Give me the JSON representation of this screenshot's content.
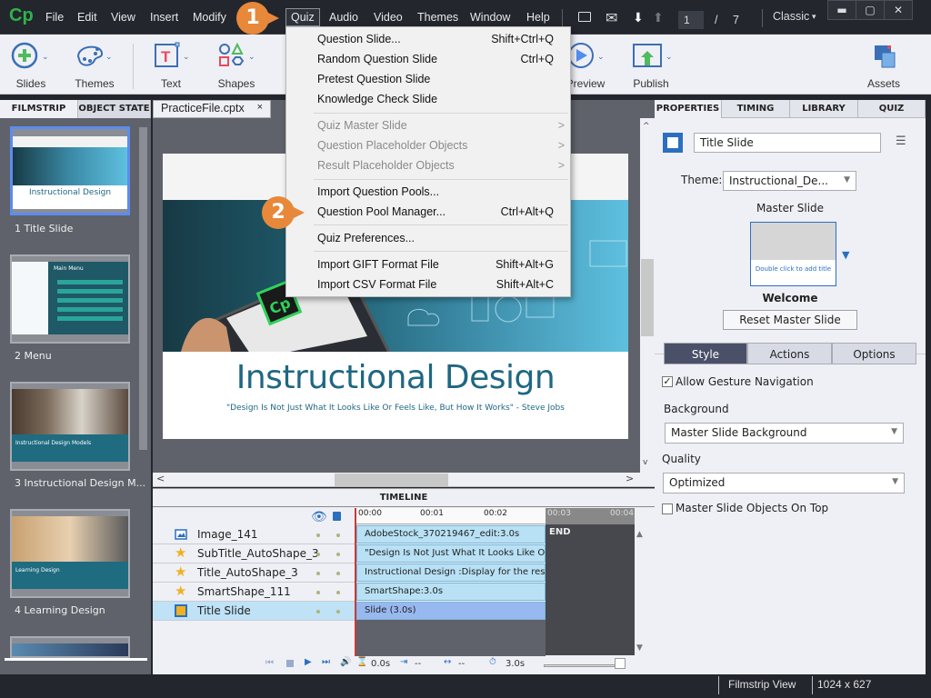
{
  "app": {
    "logo": "Cp"
  },
  "menubar": {
    "items": [
      "File",
      "Edit",
      "View",
      "Insert",
      "Modify",
      "Quiz",
      "Audio",
      "Video",
      "Themes",
      "Window",
      "Help"
    ],
    "active": "Quiz",
    "page_current": "1",
    "page_sep": "/",
    "page_total": "7",
    "workspace": "Classic",
    "workspace_arrow": "▾",
    "window_controls": {
      "minimize": "▬",
      "maximize": "▢",
      "close": "✕"
    }
  },
  "toolbar": {
    "items": [
      {
        "label": "Slides",
        "icon": "add-slide-icon"
      },
      {
        "label": "Themes",
        "icon": "palette-icon"
      },
      {
        "label": "Text",
        "icon": "text-icon"
      },
      {
        "label": "Shapes",
        "icon": "shapes-icon"
      },
      {
        "label": "Preview",
        "icon": "play-icon"
      },
      {
        "label": "Publish",
        "icon": "publish-icon"
      },
      {
        "label": "Assets",
        "icon": "assets-icon"
      }
    ]
  },
  "quiz_menu": {
    "items": [
      {
        "label": "Question Slide...",
        "shortcut": "Shift+Ctrl+Q",
        "disabled": false
      },
      {
        "label": "Random Question Slide",
        "shortcut": "Ctrl+Q",
        "disabled": false
      },
      {
        "label": "Pretest Question Slide",
        "shortcut": "",
        "disabled": false
      },
      {
        "label": "Knowledge Check Slide",
        "shortcut": "",
        "disabled": false
      },
      {
        "label": "Quiz Master Slide",
        "shortcut": "",
        "disabled": true,
        "submenu": true
      },
      {
        "label": "Question Placeholder Objects",
        "shortcut": "",
        "disabled": true,
        "submenu": true
      },
      {
        "label": "Result Placeholder Objects",
        "shortcut": "",
        "disabled": true,
        "submenu": true
      },
      {
        "label": "Import Question Pools...",
        "shortcut": "",
        "disabled": false
      },
      {
        "label": "Question Pool Manager...",
        "shortcut": "Ctrl+Alt+Q",
        "disabled": false
      },
      {
        "label": "Quiz Preferences...",
        "shortcut": "",
        "disabled": false
      },
      {
        "label": "Import GIFT Format File",
        "shortcut": "Shift+Alt+G",
        "disabled": false
      },
      {
        "label": "Import CSV Format File",
        "shortcut": "Shift+Alt+C",
        "disabled": false
      }
    ],
    "submenu_arrow": ">"
  },
  "callouts": {
    "step1": "1",
    "step2": "2",
    "color": "#e8883a"
  },
  "left_panel": {
    "tabs": [
      "FILMSTRIP",
      "OBJECT STATE"
    ],
    "slides": [
      {
        "label": "1 Title Slide",
        "thumb_title": "Instructional Design",
        "selected": true
      },
      {
        "label": "2 Menu",
        "thumb_title": "Main Menu"
      },
      {
        "label": "3 Instructional Design M...",
        "thumb_title": "Instructional Design Models"
      },
      {
        "label": "4 Learning Design",
        "thumb_title": "Learning Design"
      }
    ]
  },
  "document": {
    "tab": "PracticeFile.cptx",
    "close": "×",
    "slide_title": "Instructional Design",
    "slide_subtitle": "\"Design Is Not Just What It Looks Like Or Feels Like, But How It Works\" - Steve Jobs"
  },
  "timeline": {
    "header": "TIMELINE",
    "ticks": [
      "00:00",
      "00:01",
      "00:02",
      "00:03",
      "00:04"
    ],
    "end_label": "END",
    "layers": [
      {
        "name": "Image_141",
        "icon": "image-icon",
        "bar": "AdobeStock_370219467_edit:3.0s"
      },
      {
        "name": "SubTitle_AutoShape_3",
        "icon": "star-icon",
        "bar": "\"Design Is Not Just What It Looks Like Or F..."
      },
      {
        "name": "Title_AutoShape_3",
        "icon": "star-icon",
        "bar": "Instructional Design :Display for the rest of ..."
      },
      {
        "name": "SmartShape_111",
        "icon": "star-icon",
        "bar": "SmartShape:3.0s"
      },
      {
        "name": "Title Slide",
        "icon": "slide-icon",
        "bar": "Slide (3.0s)",
        "selected": true
      }
    ],
    "controls": {
      "current_time": "0.0s",
      "start": "--",
      "duration_marker": "--",
      "total": "3.0s"
    }
  },
  "right_panel": {
    "tabs": [
      "PROPERTIES",
      "TIMING",
      "LIBRARY",
      "QUIZ"
    ],
    "slide_name": "Title Slide",
    "theme_label": "Theme:",
    "theme_value": "Instructional_De...",
    "master_slide_label": "Master Slide",
    "master_thumb_text": "Double click to add title",
    "master_name": "Welcome",
    "reset_button": "Reset Master Slide",
    "segments": [
      "Style",
      "Actions",
      "Options"
    ],
    "active_segment": "Style",
    "allow_gesture": {
      "label": "Allow Gesture Navigation",
      "checked": true
    },
    "background_label": "Background",
    "background_value": "Master Slide Background",
    "quality_label": "Quality",
    "quality_value": "Optimized",
    "master_on_top": {
      "label": "Master Slide Objects On Top",
      "checked": false
    }
  },
  "status_bar": {
    "view": "Filmstrip View",
    "resolution": "1024 x 627"
  }
}
